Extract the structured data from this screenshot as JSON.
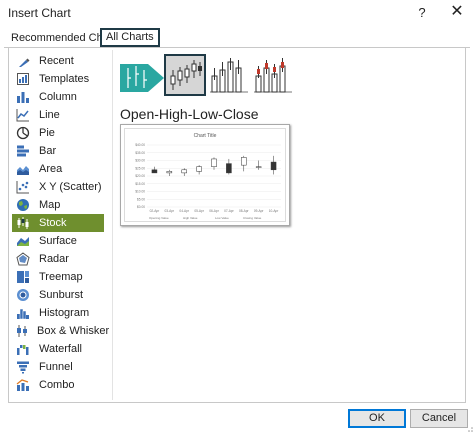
{
  "window": {
    "title": "Insert Chart",
    "help": "?",
    "close": "✕"
  },
  "tabs": [
    {
      "label": "Recommended Charts",
      "selected": false
    },
    {
      "label": "All Charts",
      "selected": true
    }
  ],
  "categories": [
    {
      "label": "Recent",
      "icon": "recent-icon"
    },
    {
      "label": "Templates",
      "icon": "templates-icon"
    },
    {
      "label": "Column",
      "icon": "column-chart-icon"
    },
    {
      "label": "Line",
      "icon": "line-chart-icon"
    },
    {
      "label": "Pie",
      "icon": "pie-chart-icon"
    },
    {
      "label": "Bar",
      "icon": "bar-chart-icon"
    },
    {
      "label": "Area",
      "icon": "area-chart-icon"
    },
    {
      "label": "X Y (Scatter)",
      "icon": "scatter-chart-icon"
    },
    {
      "label": "Map",
      "icon": "map-chart-icon"
    },
    {
      "label": "Stock",
      "icon": "stock-chart-icon",
      "selected": true
    },
    {
      "label": "Surface",
      "icon": "surface-chart-icon"
    },
    {
      "label": "Radar",
      "icon": "radar-chart-icon"
    },
    {
      "label": "Treemap",
      "icon": "treemap-chart-icon"
    },
    {
      "label": "Sunburst",
      "icon": "sunburst-chart-icon"
    },
    {
      "label": "Histogram",
      "icon": "histogram-chart-icon"
    },
    {
      "label": "Box & Whisker",
      "icon": "box-whisker-chart-icon"
    },
    {
      "label": "Waterfall",
      "icon": "waterfall-chart-icon"
    },
    {
      "label": "Funnel",
      "icon": "funnel-chart-icon"
    },
    {
      "label": "Combo",
      "icon": "combo-chart-icon"
    }
  ],
  "subtypes": [
    {
      "icon": "high-low-close-icon",
      "selected": false
    },
    {
      "icon": "open-high-low-close-icon",
      "selected": true
    },
    {
      "icon": "volume-high-low-close-icon",
      "selected": false
    },
    {
      "icon": "volume-open-high-low-close-icon",
      "selected": false
    }
  ],
  "selected_subtype_name": "Open-High-Low-Close",
  "preview": {
    "chart_title": "Chart Title",
    "y_ticks": [
      "$40.00",
      "$35.00",
      "$30.00",
      "$25.00",
      "$20.00",
      "$15.00",
      "$10.00",
      "$5.00",
      "$0.00"
    ],
    "x_ticks": [
      "02-Apr",
      "03-Apr",
      "04-Apr",
      "05-Apr",
      "06-Apr",
      "07-Apr",
      "08-Apr",
      "09-Apr",
      "10-Apr"
    ],
    "legend": [
      "Opening Value",
      "High Value",
      "Low Value",
      "Closing Value"
    ]
  },
  "chart_data": {
    "type": "candlestick",
    "title": "Chart Title",
    "categories": [
      "02-Apr",
      "03-Apr",
      "04-Apr",
      "05-Apr",
      "06-Apr",
      "07-Apr",
      "08-Apr",
      "09-Apr",
      "10-Apr"
    ],
    "ylim": [
      0,
      40
    ],
    "series": [
      {
        "name": "Opening Value",
        "values": [
          24,
          22,
          22,
          23,
          26,
          28,
          27,
          26,
          29
        ]
      },
      {
        "name": "High Value",
        "values": [
          26,
          24,
          25,
          27,
          32,
          31,
          33,
          30,
          33
        ]
      },
      {
        "name": "Low Value",
        "values": [
          22,
          20,
          20,
          21,
          24,
          21,
          23,
          24,
          21
        ]
      },
      {
        "name": "Closing Value",
        "values": [
          22,
          23,
          24,
          26,
          31,
          22,
          32,
          26,
          24
        ]
      }
    ]
  },
  "buttons": {
    "ok": "OK",
    "cancel": "Cancel"
  },
  "colors": {
    "selected_category_bg": "#6f8f2e",
    "tab_border": "#1f3a46",
    "accent_teal": "#2aa7a1"
  }
}
